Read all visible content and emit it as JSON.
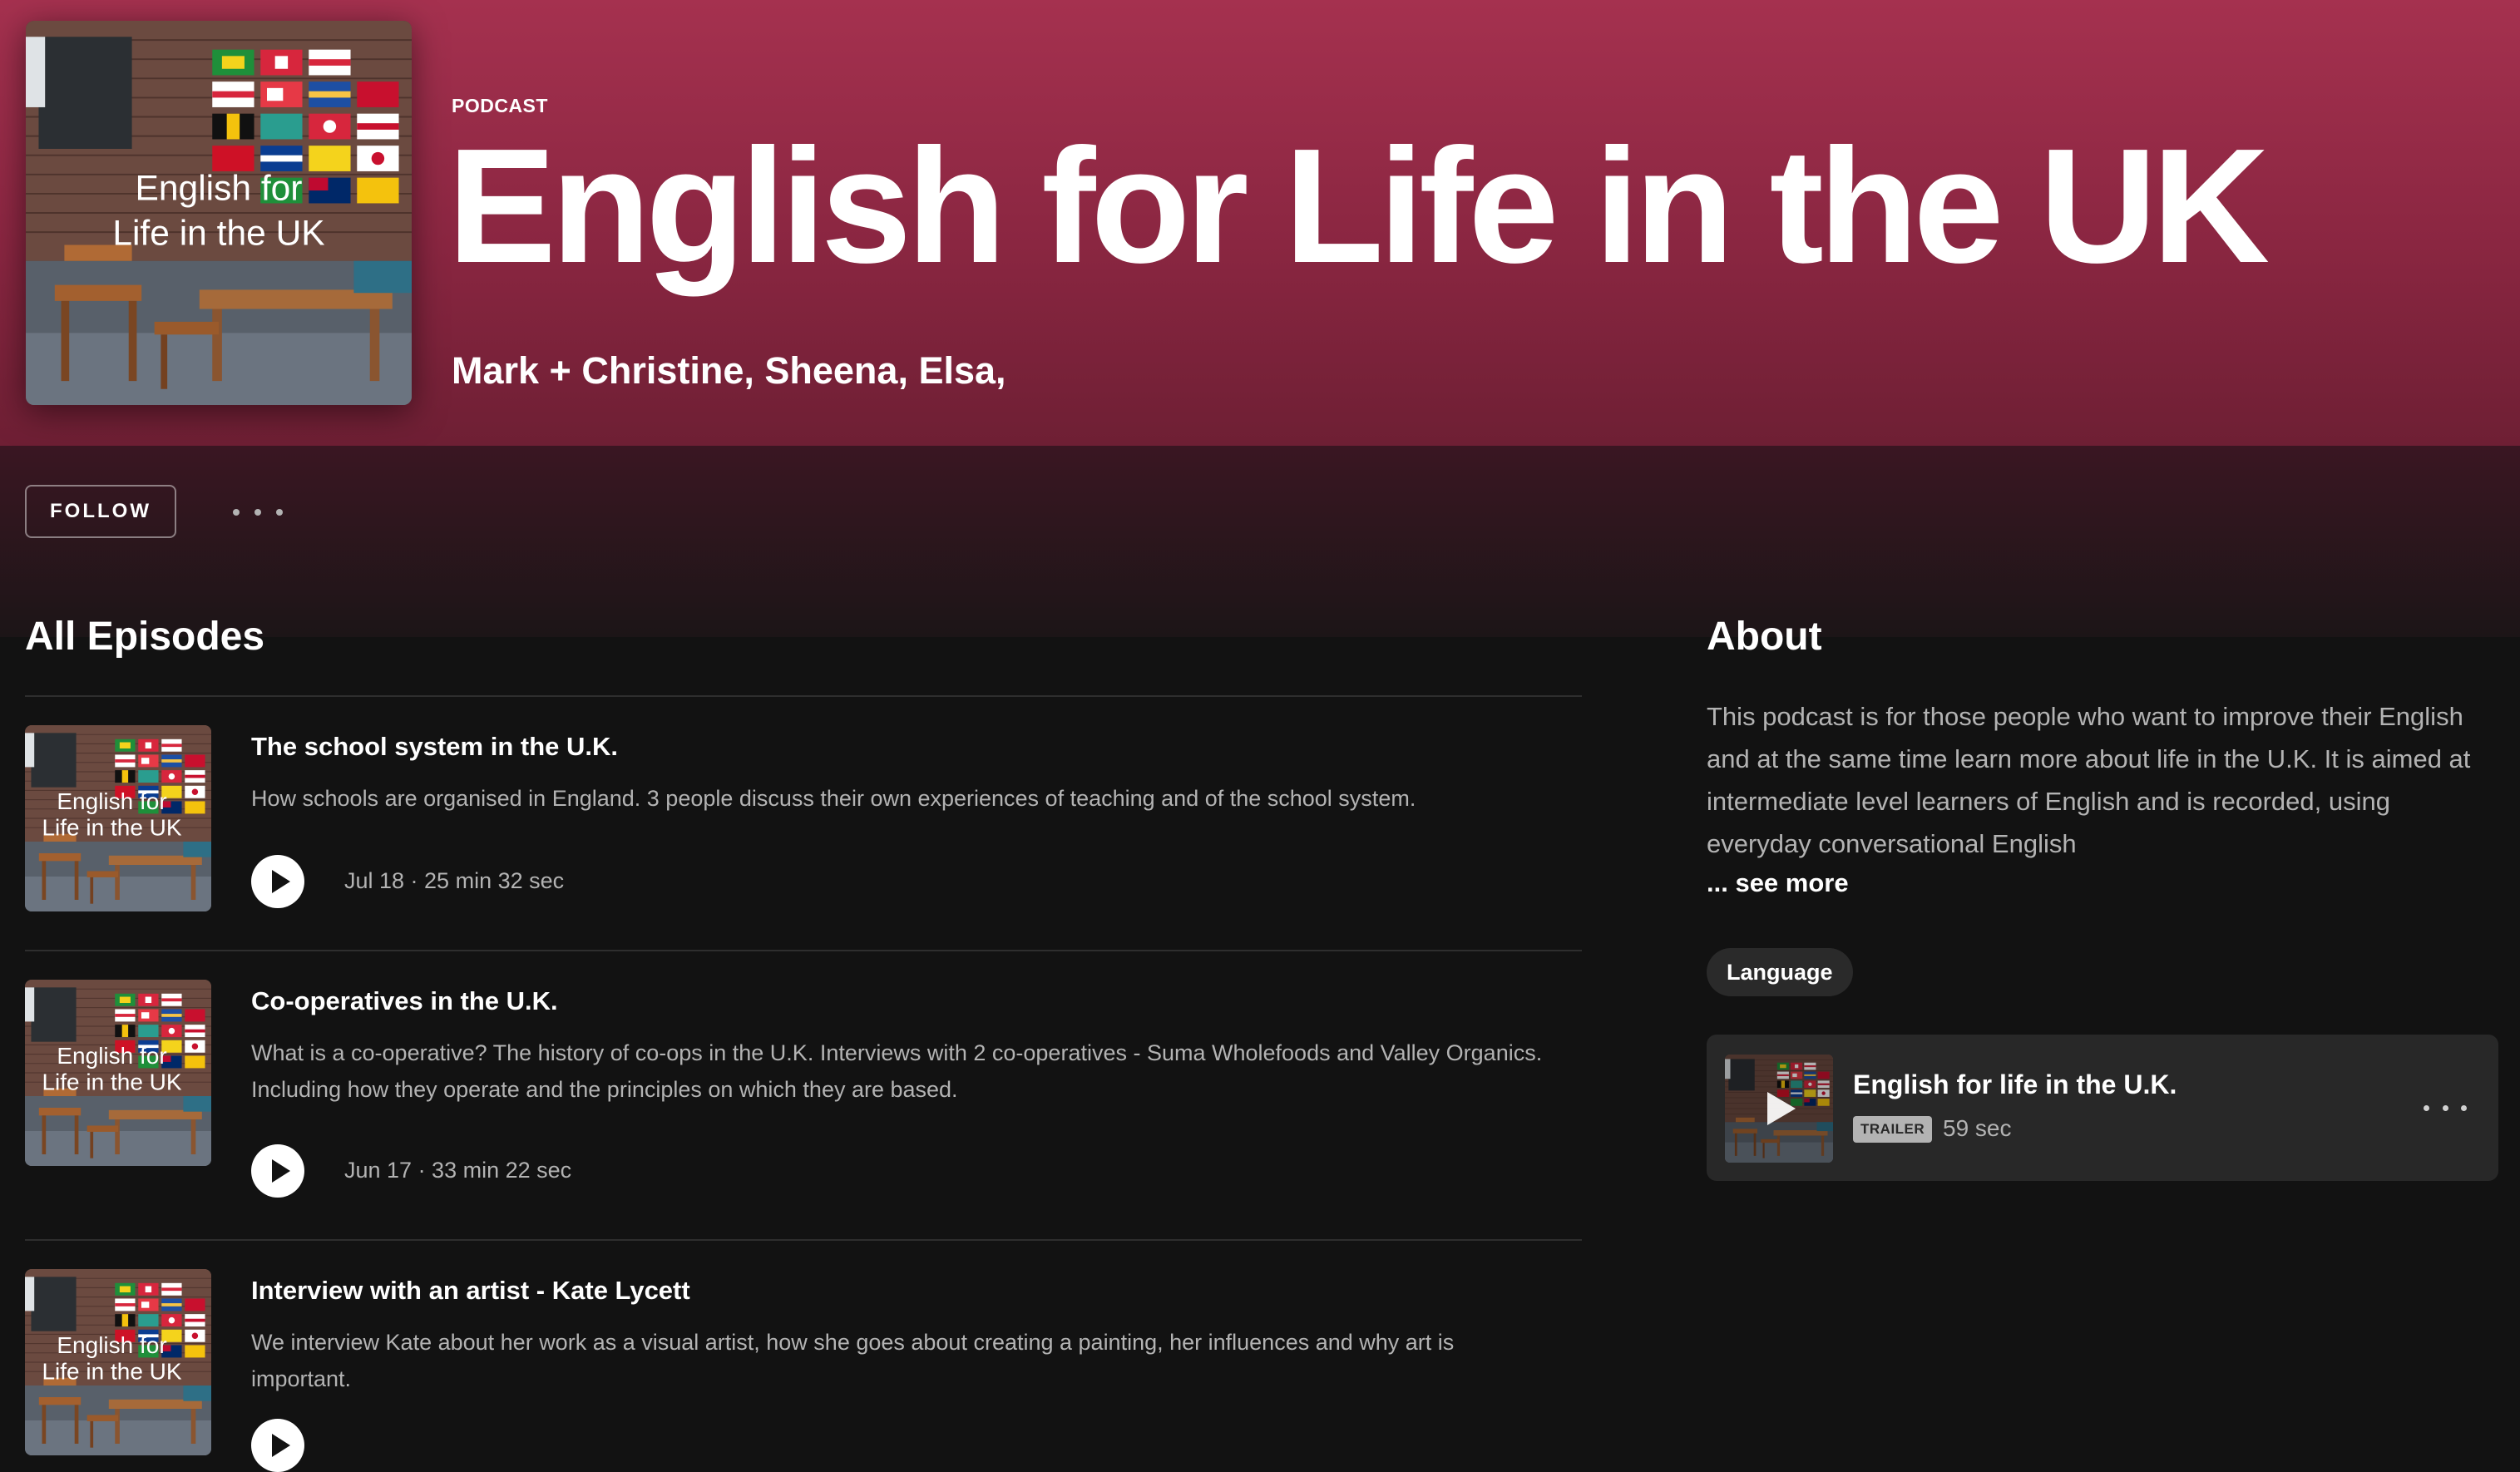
{
  "colors": {
    "header_gradient_top": "#a5314f",
    "header_gradient_bottom": "#6e1f34",
    "background": "#121212",
    "card": "#282828",
    "text_primary": "#ffffff",
    "text_secondary": "#b3b3b3"
  },
  "header": {
    "kicker": "PODCAST",
    "title": "English for Life in the UK",
    "authors": "Mark + Christine, Sheena, Elsa,",
    "cover_text": [
      "English for",
      "Life in the UK"
    ]
  },
  "actions": {
    "follow_label": "FOLLOW",
    "more_icon": "more-horizontal-icon"
  },
  "episodes_section": {
    "title": "All Episodes",
    "items": [
      {
        "title": "The school system in the U.K.",
        "description": "How schools are organised in England. 3 people discuss their own experiences of teaching and of the school system.",
        "meta": "Jul 18 · 25 min 32 sec"
      },
      {
        "title": "Co-operatives in the U.K.",
        "description": "What is a co-operative? The history of co-ops in the U.K. Interviews with 2 co-operatives - Suma Wholefoods and Valley Organics. Including how they operate and the principles on which they are based.",
        "meta": "Jun 17 · 33 min 22 sec"
      },
      {
        "title": "Interview with an artist - Kate Lycett",
        "description": "We interview Kate about her work as a visual artist, how she goes about creating a painting, her influences and why art is important.",
        "meta": ""
      }
    ]
  },
  "about": {
    "title": "About",
    "text": "This podcast is for those people who want to improve their English and at the same time learn more about life in the U.K. It is aimed at intermediate level learners of English and is recorded, using everyday conversational English",
    "see_more": "... see more",
    "tag": "Language",
    "trailer": {
      "title": "English for life in the U.K.",
      "badge": "TRAILER",
      "duration": "59 sec"
    }
  }
}
